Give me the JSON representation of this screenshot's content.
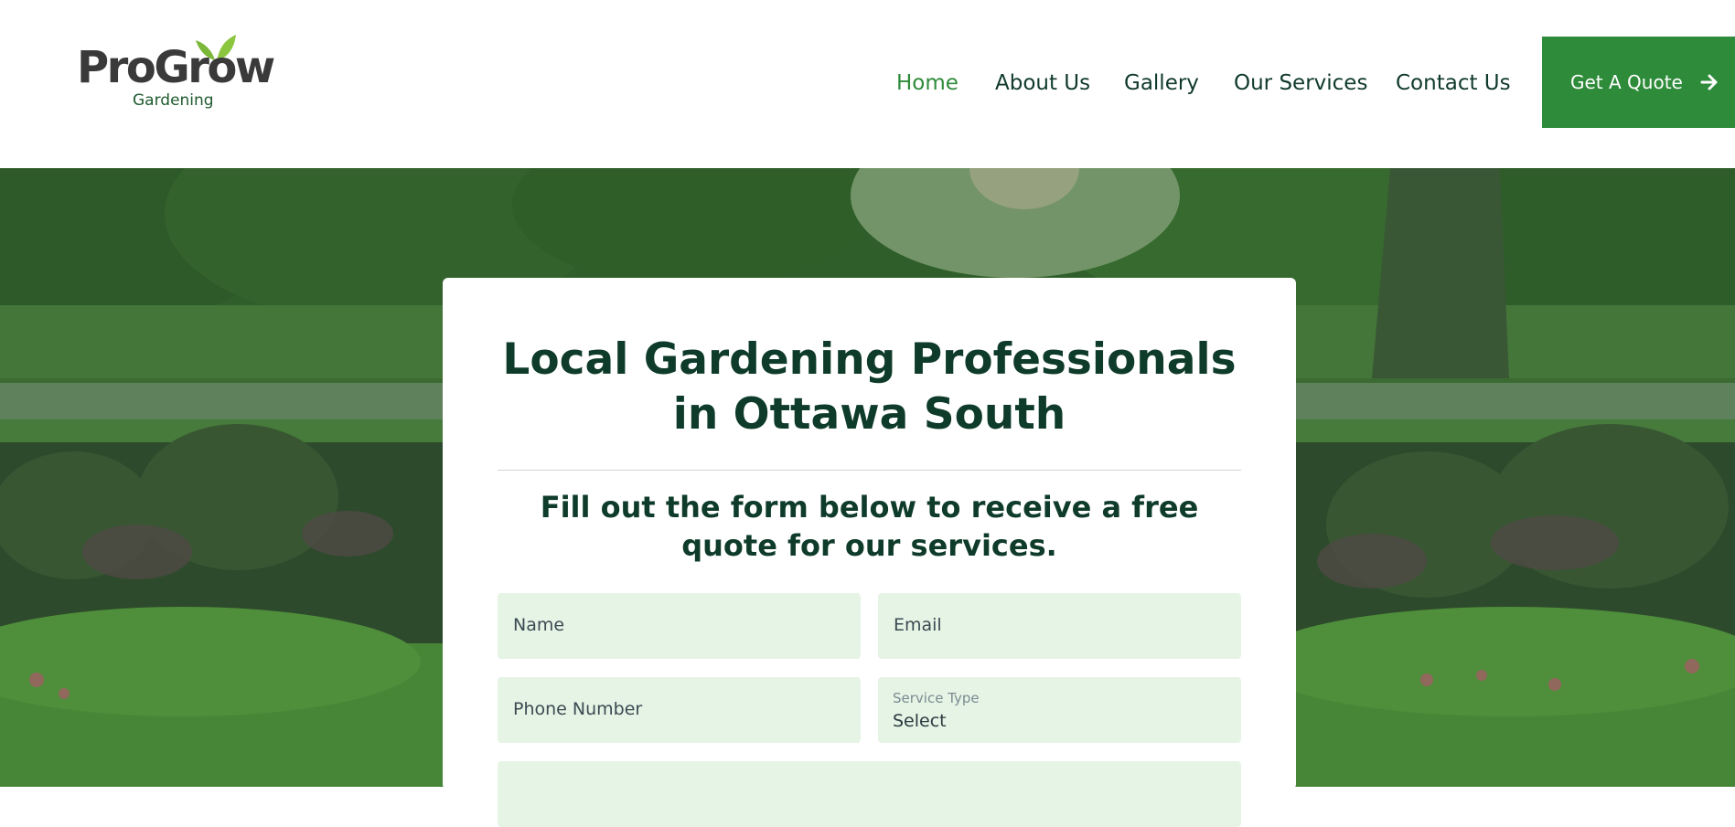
{
  "header": {
    "logo": {
      "word": "ProGrow",
      "sub": "Gardening"
    },
    "nav": [
      {
        "label": "Home",
        "active": true
      },
      {
        "label": "About Us",
        "active": false
      },
      {
        "label": "Gallery",
        "active": false
      },
      {
        "label": "Our Services",
        "active": false
      },
      {
        "label": "Contact Us",
        "active": false
      }
    ],
    "cta": {
      "label": "Get A Quote",
      "icon": "arrow-right-icon"
    }
  },
  "form_card": {
    "title_line1": "Local Gardening Professionals",
    "title_line2": "in Ottawa South",
    "subtitle": "Fill out the form below to receive a free quote for our services.",
    "fields": {
      "name": {
        "placeholder": "Name"
      },
      "email": {
        "placeholder": "Email"
      },
      "phone": {
        "placeholder": "Phone Number"
      },
      "service_type": {
        "label": "Service Type",
        "value": "Select"
      }
    }
  },
  "colors": {
    "brand_green": "#2e8b3a",
    "dark_text": "#0e3b2a",
    "field_bg": "#e6f4e6"
  }
}
